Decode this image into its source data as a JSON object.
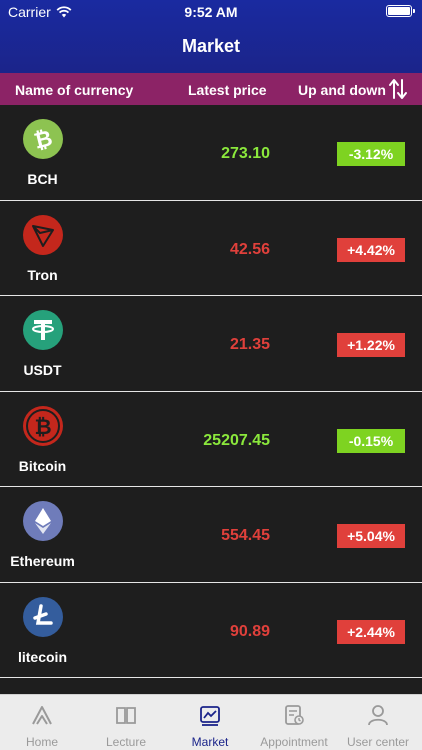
{
  "status_bar": {
    "carrier": "Carrier",
    "time": "9:52 AM"
  },
  "nav": {
    "title": "Market"
  },
  "columns": {
    "name": "Name of currency",
    "price": "Latest price",
    "change": "Up and down"
  },
  "coins": [
    {
      "name": "BCH",
      "price": "273.10",
      "change": "-3.12%",
      "trend": "down",
      "icon": "bitcoin-cash-icon",
      "color": "#8dc351"
    },
    {
      "name": "Tron",
      "price": "42.56",
      "change": "+4.42%",
      "trend": "up",
      "icon": "tron-icon",
      "color": "#c4271c"
    },
    {
      "name": "USDT",
      "price": "21.35",
      "change": "+1.22%",
      "trend": "up",
      "icon": "tether-icon",
      "color": "#26a17b"
    },
    {
      "name": "Bitcoin",
      "price": "25207.45",
      "change": "-0.15%",
      "trend": "down",
      "icon": "bitcoin-icon",
      "color": "#c4271c"
    },
    {
      "name": "Ethereum",
      "price": "554.45",
      "change": "+5.04%",
      "trend": "up",
      "icon": "ethereum-icon",
      "color": "#6f7cba"
    },
    {
      "name": "litecoin",
      "price": "90.89",
      "change": "+2.44%",
      "trend": "up",
      "icon": "litecoin-icon",
      "color": "#345d9d"
    }
  ],
  "tabs": [
    {
      "label": "Home",
      "icon": "home-icon",
      "active": false
    },
    {
      "label": "Lecture",
      "icon": "book-icon",
      "active": false
    },
    {
      "label": "Market",
      "icon": "chart-icon",
      "active": true
    },
    {
      "label": "Appointment",
      "icon": "appointment-icon",
      "active": false
    },
    {
      "label": "User center",
      "icon": "user-icon",
      "active": false
    }
  ],
  "colors": {
    "header": "#1b248a",
    "column_header": "#8c2366",
    "up": "#e0403b",
    "down": "#7ed321"
  }
}
